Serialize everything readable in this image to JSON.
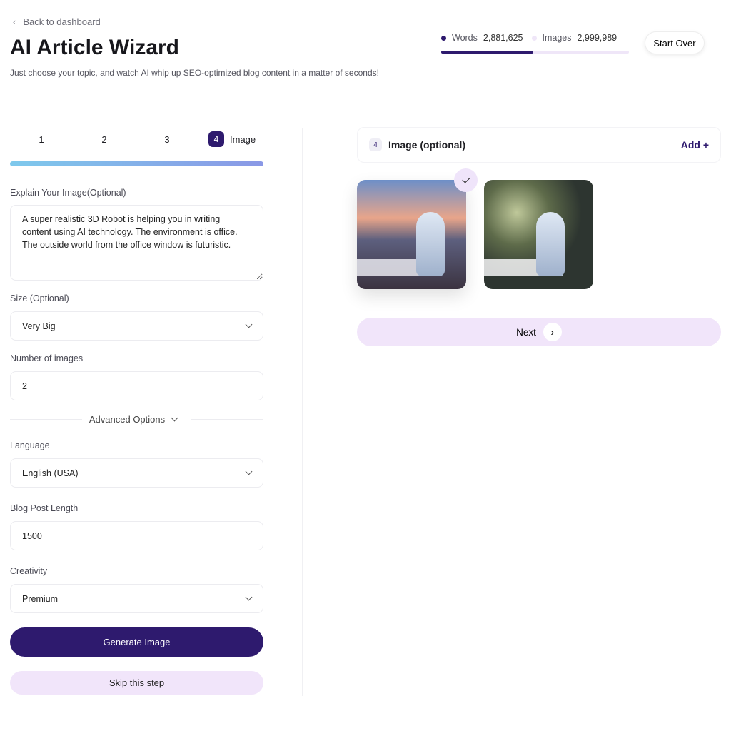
{
  "header": {
    "back_label": "Back to dashboard",
    "title": "AI Article Wizard",
    "subtitle": "Just choose your topic, and watch AI whip up SEO-optimized blog content in a matter of seconds!",
    "start_over": "Start Over"
  },
  "stats": {
    "words_label": "Words",
    "words_value": "2,881,625",
    "images_label": "Images",
    "images_value": "2,999,989",
    "words_progress_percent": 49,
    "colors": {
      "words": "#2e1a6e",
      "images": "#efe6f8"
    }
  },
  "steps": {
    "items": [
      "1",
      "2",
      "3"
    ],
    "active_number": "4",
    "active_label": "Image"
  },
  "form": {
    "explain_label": "Explain Your Image(Optional)",
    "explain_value": "A super realistic 3D Robot is helping you in writing content using AI technology. The environment is office. The outside world from the office window is futuristic.",
    "size_label": "Size (Optional)",
    "size_value": "Very Big",
    "count_label": "Number of images",
    "count_value": "2",
    "advanced_label": "Advanced Options",
    "language_label": "Language",
    "language_value": "English (USA)",
    "length_label": "Blog Post Length",
    "length_value": "1500",
    "creativity_label": "Creativity",
    "creativity_value": "Premium",
    "generate_label": "Generate Image",
    "skip_label": "Skip this step"
  },
  "panel": {
    "badge": "4",
    "title": "Image (optional)",
    "add_label": "Add +",
    "next_label": "Next",
    "selected_image": 1
  },
  "accent": "#2e1a6e"
}
